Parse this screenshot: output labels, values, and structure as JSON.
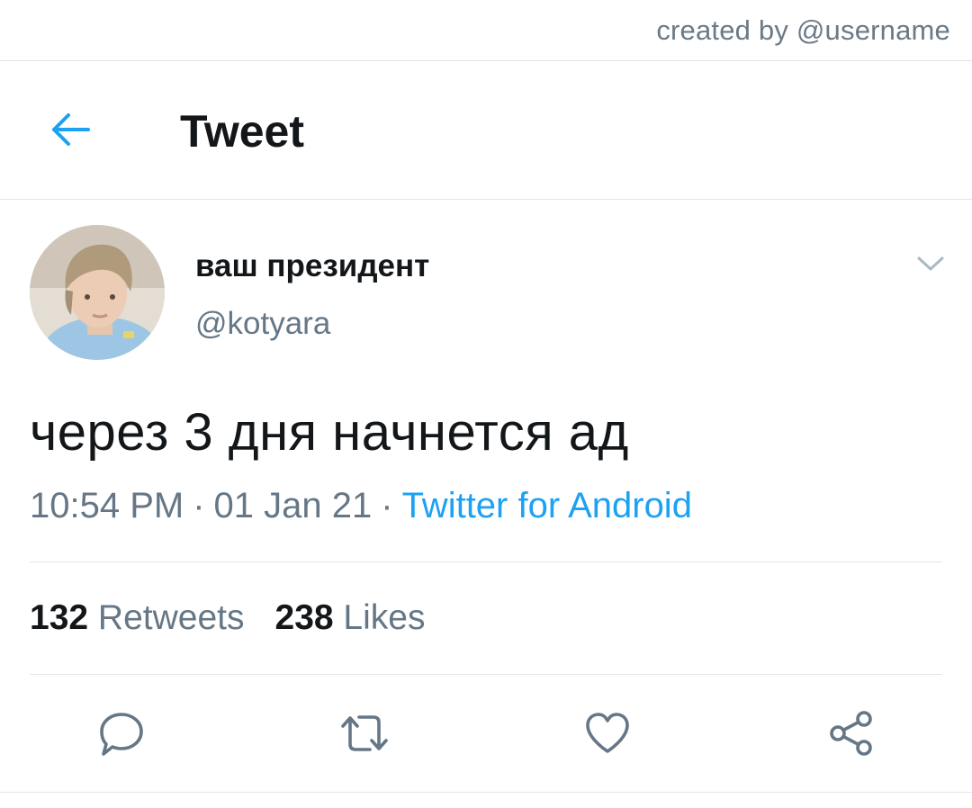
{
  "credit": "created by @username",
  "header": {
    "back_icon": "arrow-left-icon",
    "title": "Tweet",
    "accent": "#1da1f2"
  },
  "tweet": {
    "display_name": "ваш президент",
    "handle": "@kotyara",
    "text": "через 3 дня начнется ад",
    "time": "10:54 PM",
    "separator": "·",
    "date": "01 Jan 21",
    "source": "Twitter for Android",
    "stats": {
      "retweets_count": "132",
      "retweets_label": "Retweets",
      "likes_count": "238",
      "likes_label": "Likes"
    }
  },
  "actions": [
    "reply-icon",
    "retweet-icon",
    "like-icon",
    "share-icon"
  ],
  "colors": {
    "text": "#14171a",
    "secondary": "#657786",
    "divider": "#e1e6ea",
    "link": "#1da1f2"
  }
}
